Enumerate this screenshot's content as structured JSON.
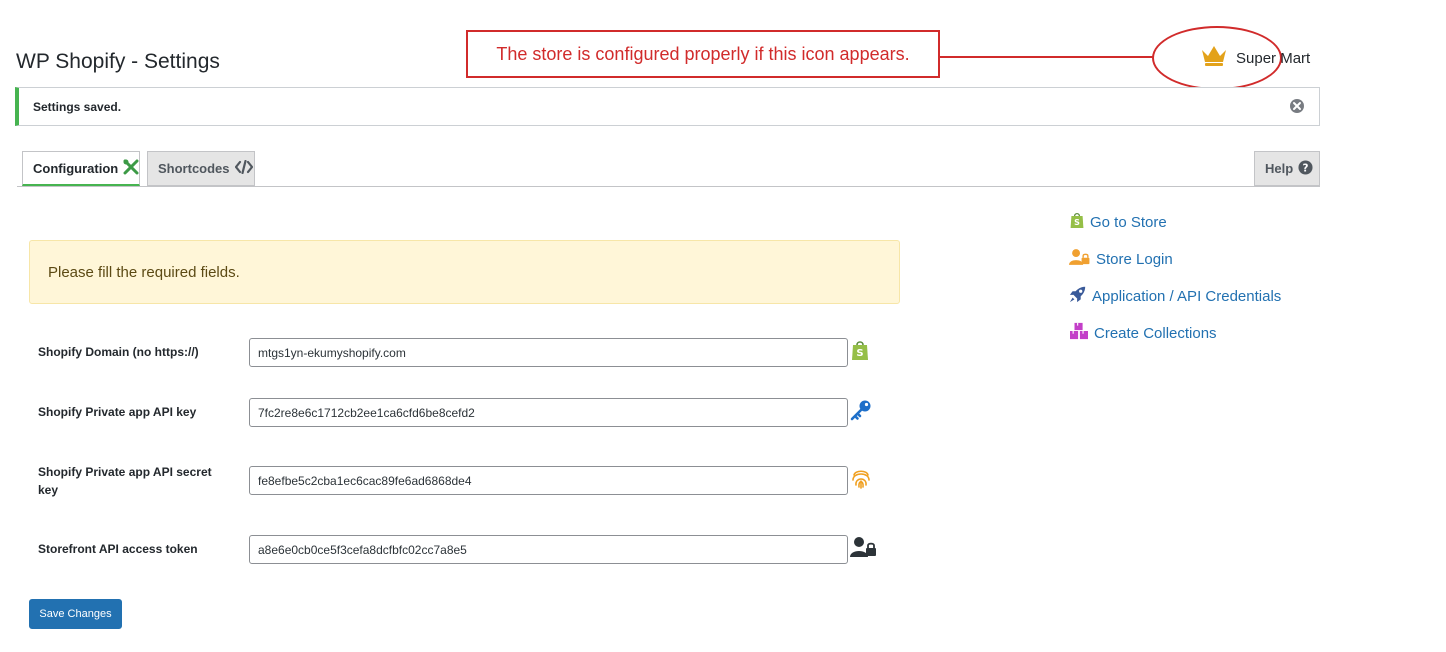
{
  "header": {
    "title": "WP Shopify - Settings",
    "store_name": "Super Mart",
    "store_icon": "crown-icon"
  },
  "annotation": {
    "text": "The store is configured properly if this icon appears."
  },
  "notice": {
    "text": "Settings saved.",
    "dismiss_icon": "close-circle-icon"
  },
  "tabs": [
    {
      "label": "Configuration",
      "icon": "tools-icon",
      "active": true
    },
    {
      "label": "Shortcodes",
      "icon": "code-icon",
      "active": false
    }
  ],
  "help": {
    "label": "Help",
    "icon": "question-circle-icon"
  },
  "warning": {
    "text": "Please fill the required fields."
  },
  "fields": [
    {
      "label": "Shopify Domain (no https://)",
      "value": "mtgs1yn-ekumyshopify.com",
      "icon": "shopify-bag-icon"
    },
    {
      "label": "Shopify Private app API key",
      "value": "7fc2re8e6c1712cb2ee1ca6cfd6be8cefd2",
      "icon": "key-icon"
    },
    {
      "label": "Shopify Private app API secret key",
      "value": "fe8efbe5c2cba1ec6cac89fe6ad6868de4",
      "icon": "fingerprint-icon"
    },
    {
      "label": "Storefront API access token",
      "value": "a8e6e0cb0ce5f3cefa8dcfbfc02cc7a8e5",
      "icon": "user-lock-icon"
    }
  ],
  "save_button": {
    "label": "Save Changes"
  },
  "sidebar_links": [
    {
      "label": "Go to Store",
      "icon": "shopify-bag-icon",
      "color": "#95bf47"
    },
    {
      "label": "Store Login",
      "icon": "user-lock-icon",
      "color": "#f0a030"
    },
    {
      "label": "Application / API Credentials",
      "icon": "rocket-icon",
      "color": "#3a5a99"
    },
    {
      "label": "Create Collections",
      "icon": "boxes-icon",
      "color": "#c33fc8"
    }
  ],
  "colors": {
    "accent": "#2271b1",
    "success": "#46b450",
    "callout": "#d12b2b",
    "crown": "#e3a21a"
  }
}
